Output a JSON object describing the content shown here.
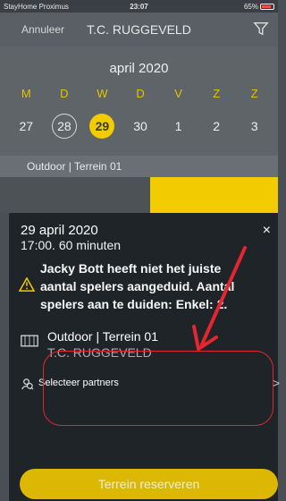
{
  "status": {
    "carrier": "StayHome Proximus",
    "time": "23:07",
    "battery": "65%"
  },
  "header": {
    "cancel": "Annuleer",
    "title": "T.C. RUGGEVELD"
  },
  "calendar": {
    "month": "april 2020",
    "weekdays": [
      "M",
      "D",
      "W",
      "D",
      "V",
      "Z",
      "Z"
    ],
    "days": [
      "27",
      "28",
      "29",
      "30",
      "1",
      "2",
      "3"
    ]
  },
  "terrain": {
    "label": "Outdoor | Terrein 01"
  },
  "sheet": {
    "date": "29 april 2020",
    "duration": "17:00. 60 minuten",
    "warning_line1": "Jacky Bott heeft niet het juiste",
    "warning_line2": "aantal spelers aangeduid. Aantal",
    "warning_line3": "spelers aan te duiden: Enkel: 2.",
    "court": "Outdoor | Terrein 01",
    "club": "T.C. RUGGEVELD",
    "partners": "Selecteer partners",
    "close": "×",
    "chevron": ">"
  },
  "actions": {
    "reserve": "Terrein reserveren"
  },
  "colors": {
    "accent": "#f2cb00",
    "annotation": "#e3262f",
    "sheet_background": "#1f2429"
  },
  "icons": [
    "wifi-icon",
    "battery-icon",
    "filter-icon",
    "close-icon",
    "warning-icon",
    "court-icon",
    "search-user-icon",
    "chevron-right-icon"
  ]
}
